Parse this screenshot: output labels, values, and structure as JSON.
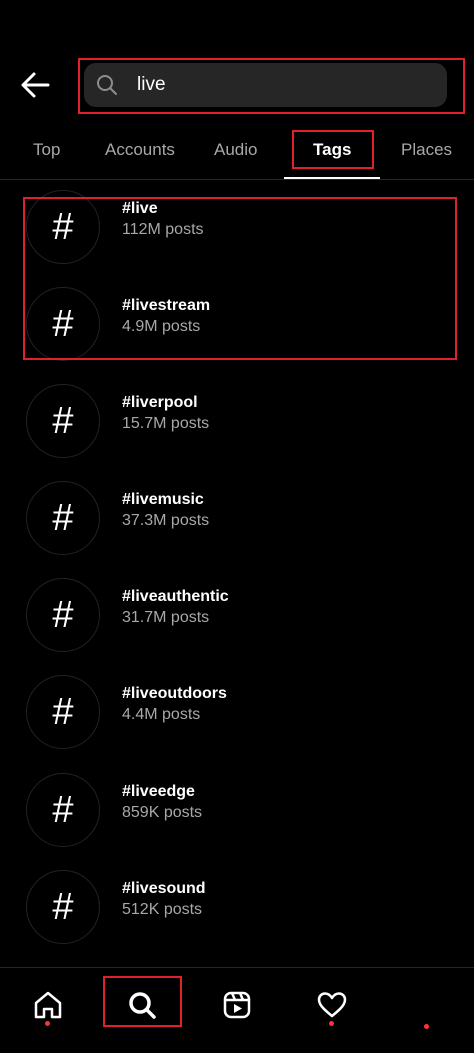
{
  "search": {
    "query": "live"
  },
  "tabs": [
    {
      "label": "Top"
    },
    {
      "label": "Accounts"
    },
    {
      "label": "Audio"
    },
    {
      "label": "Tags"
    },
    {
      "label": "Places"
    }
  ],
  "results": [
    {
      "tag": "#live",
      "count": "112M posts"
    },
    {
      "tag": "#livestream",
      "count": "4.9M posts"
    },
    {
      "tag": "#liverpool",
      "count": "15.7M posts"
    },
    {
      "tag": "#livemusic",
      "count": "37.3M posts"
    },
    {
      "tag": "#liveauthentic",
      "count": "31.7M posts"
    },
    {
      "tag": "#liveoutdoors",
      "count": "4.4M posts"
    },
    {
      "tag": "#liveedge",
      "count": "859K posts"
    },
    {
      "tag": "#livesound",
      "count": "512K posts"
    }
  ],
  "hash_glyph": "#",
  "icons": {
    "back": "arrow-left-icon",
    "search": "search-icon",
    "home": "home-icon",
    "explore": "search-icon",
    "reels": "reels-icon",
    "activity": "heart-icon"
  },
  "colors": {
    "highlight": "#e0202a",
    "notification_dot": "#ff3040",
    "secondary_text": "#a8a8a8"
  }
}
